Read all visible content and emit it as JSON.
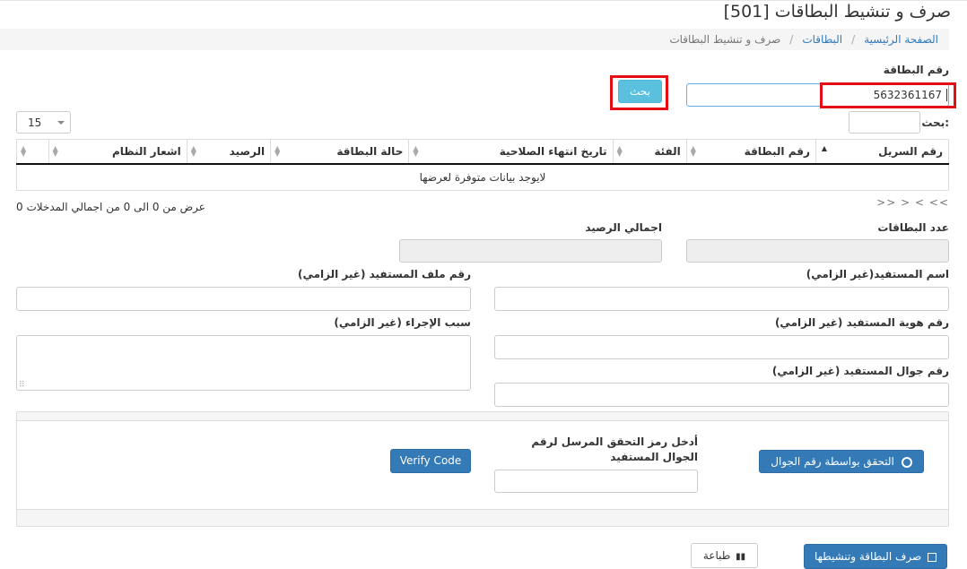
{
  "page": {
    "title": "صرف و تنشيط البطاقات [501]"
  },
  "breadcrumb": {
    "home": "الصفحة الرئيسية",
    "cards": "البطاقات",
    "current": "صرف و تنشيط البطاقات",
    "separator": "/"
  },
  "search": {
    "card_number_label": "رقم البطاقة",
    "card_number_value": "5632361167",
    "search_button": "بحث",
    "page_size": "15",
    "filter_label": ":بحث",
    "filter_value": ""
  },
  "table": {
    "columns": [
      "رقم السريل",
      "رقم البطاقة",
      "الفئة",
      "تاريخ انتهاء الصلاحية",
      "حالة البطاقة",
      "الرصيد",
      "اشعار النظام",
      ""
    ],
    "empty_message": "لايوجد بيانات متوفرة لعرضها",
    "info": "عرض من 0 الى 0 من اجمالي المدخلات 0",
    "pager": {
      "first": "<<",
      "prev": "<",
      "next": ">",
      "last": ">>"
    }
  },
  "form": {
    "card_count_label": "عدد البطاقات",
    "total_balance_label": "اجمالي الرصيد",
    "beneficiary_name_label": "اسم المستفيد(غير الزامي)",
    "beneficiary_file_label": "رقم ملف المستفيد (غير الزامي)",
    "beneficiary_id_label": "رقم هوية المستفيد (غير الزامي)",
    "reason_label": "سبب الإجراء (غير الزامي)",
    "beneficiary_mobile_label": "رقم جوال المستفيد (غير الزامي)"
  },
  "verify": {
    "verify_by_mobile_button": "التحقق بواسطة رقم الجوال",
    "code_label_line1": "أدخل رمز التحقق المرسل لرقم",
    "code_label_line2": "الجوال المستفيد",
    "code_value": "",
    "verify_code_button": "Verify Code"
  },
  "actions": {
    "issue_activate_button": "صرف البطاقة وتنشيطها",
    "print_button": "طباعة"
  },
  "colors": {
    "primary": "#337ab7",
    "info": "#5bc0de",
    "highlight": "#e30e16"
  }
}
